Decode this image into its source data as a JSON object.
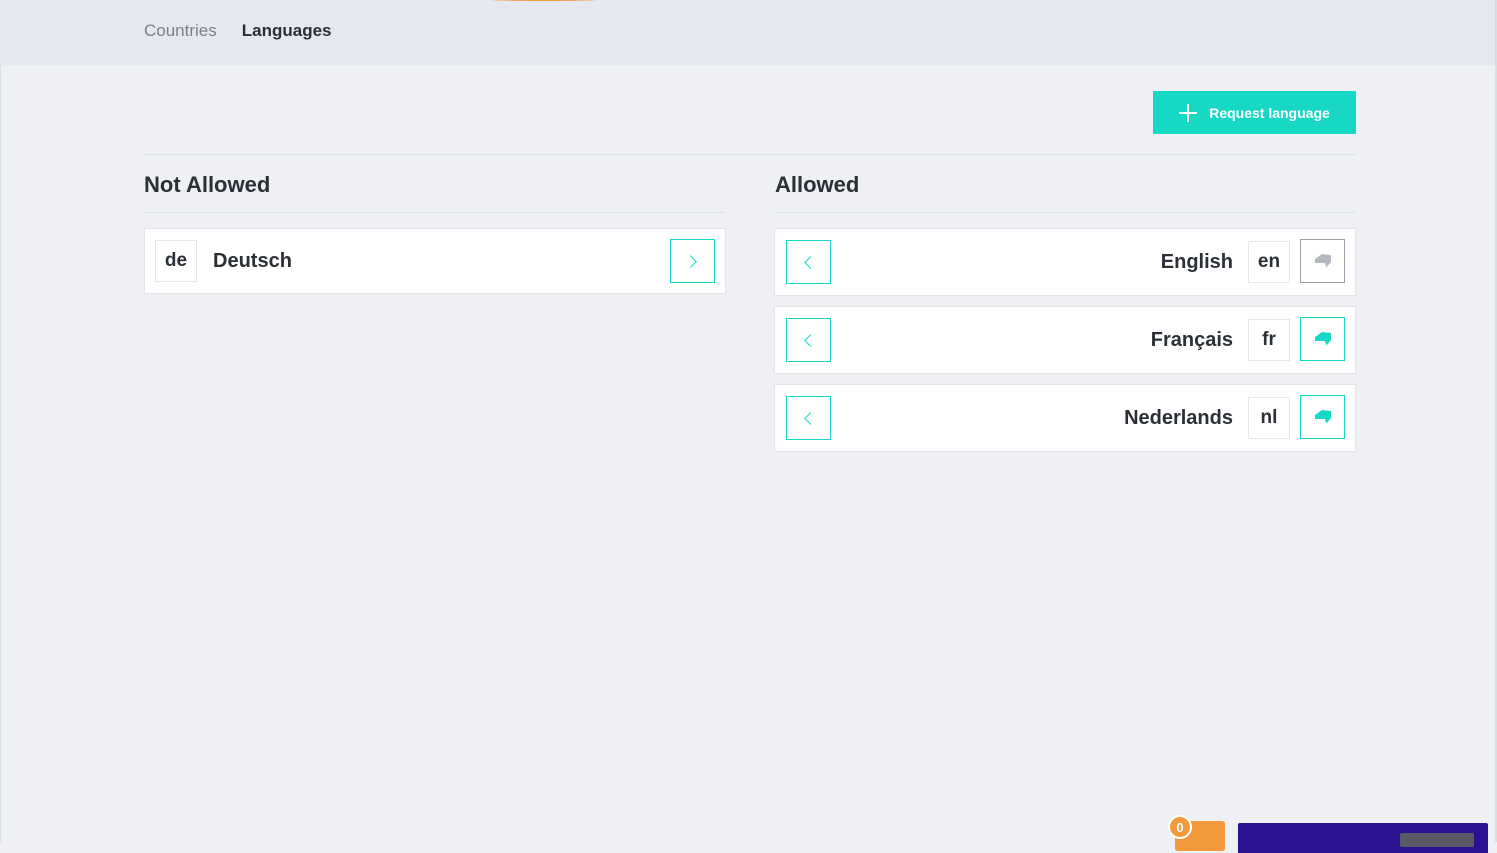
{
  "tabs": [
    {
      "label": "Countries",
      "active": false
    },
    {
      "label": "Languages",
      "active": true
    }
  ],
  "actions": {
    "request_label": "Request language"
  },
  "not_allowed": {
    "title": "Not Allowed",
    "items": [
      {
        "code": "de",
        "name": "Deutsch"
      }
    ]
  },
  "allowed": {
    "title": "Allowed",
    "items": [
      {
        "name": "English",
        "code": "en",
        "default": true
      },
      {
        "name": "Français",
        "code": "fr",
        "default": false
      },
      {
        "name": "Nederlands",
        "code": "nl",
        "default": false
      }
    ]
  },
  "cart": {
    "count": "0"
  },
  "colors": {
    "accent": "#17d8c5",
    "notification": "#f39a3d",
    "panel": "#2b1290"
  },
  "icons": {
    "request": "plus-icon",
    "move_right": "chevron-right-icon",
    "move_left": "chevron-left-icon",
    "default_flag": "tag-icon"
  }
}
